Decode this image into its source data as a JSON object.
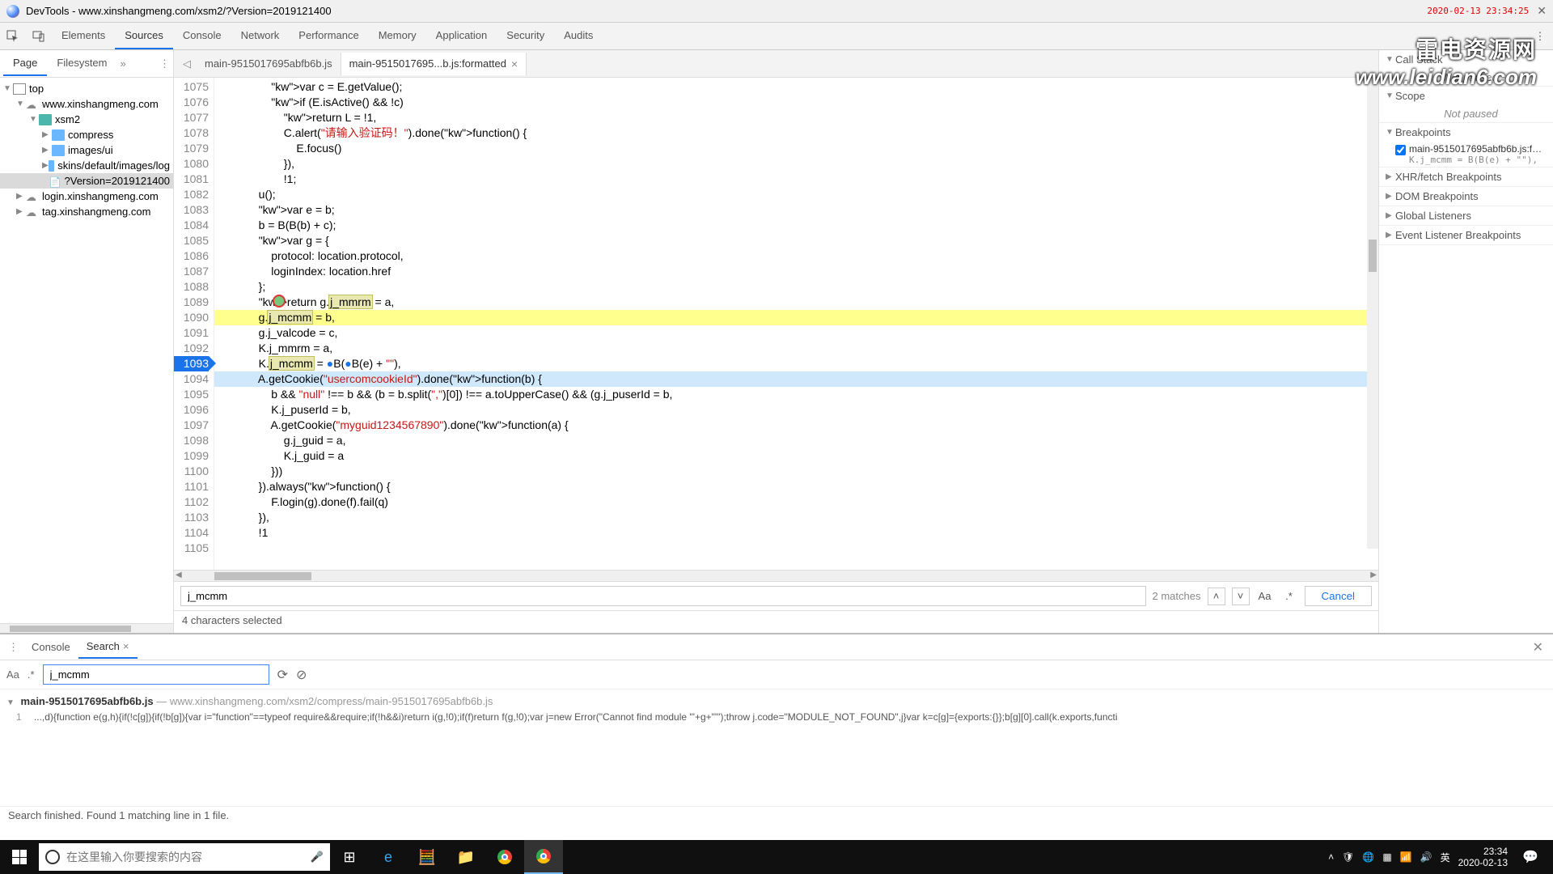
{
  "titlebar": {
    "title": "DevTools - www.xinshangmeng.com/xsm2/?Version=2019121400",
    "date_stamp": "2020-02-13 23:34:25"
  },
  "watermark": {
    "text": "雷电资源网",
    "url": "www.leidian6.com"
  },
  "devtools_tabs": [
    "Elements",
    "Sources",
    "Console",
    "Network",
    "Performance",
    "Memory",
    "Application",
    "Security",
    "Audits"
  ],
  "devtools_active": "Sources",
  "left": {
    "tabs": [
      "Page",
      "Filesystem"
    ],
    "active": "Page",
    "tree": [
      {
        "depth": 0,
        "arrow": "▼",
        "icon": "frame",
        "label": "top"
      },
      {
        "depth": 1,
        "arrow": "▼",
        "icon": "cloud",
        "label": "www.xinshangmeng.com"
      },
      {
        "depth": 2,
        "arrow": "▼",
        "icon": "folder-teal",
        "label": "xsm2"
      },
      {
        "depth": 3,
        "arrow": "▶",
        "icon": "folder-blue",
        "label": "compress"
      },
      {
        "depth": 3,
        "arrow": "▶",
        "icon": "folder-blue",
        "label": "images/ui"
      },
      {
        "depth": 3,
        "arrow": "▶",
        "icon": "folder-blue",
        "label": "skins/default/images/log"
      },
      {
        "depth": 3,
        "arrow": "",
        "icon": "file",
        "label": "?Version=2019121400",
        "selected": true
      },
      {
        "depth": 1,
        "arrow": "▶",
        "icon": "cloud",
        "label": "login.xinshangmeng.com"
      },
      {
        "depth": 1,
        "arrow": "▶",
        "icon": "cloud",
        "label": "tag.xinshangmeng.com"
      }
    ]
  },
  "editor": {
    "tabs": [
      {
        "label": "main-9515017695abfb6b.js",
        "active": false
      },
      {
        "label": "main-9515017695...b.js:formatted",
        "active": true
      }
    ],
    "first_line": 1075,
    "bp_line": 1093,
    "hl_line": 1090,
    "blue_line": 1094,
    "marker_line": 1089,
    "lines": [
      "                var c = E.getValue();",
      "                if (E.isActive() && !c)",
      "                    return L = !1,",
      "                    C.alert(\"请输入验证码！\").done(function() {",
      "                        E.focus()",
      "                    }),",
      "                    !1;",
      "            u();",
      "            var e = b;",
      "            b = B(B(b) + c);",
      "            var g = {",
      "                protocol: location.protocol,",
      "                loginIndex: location.href",
      "            };",
      "            return g.j_mmrm = a,",
      "            g.j_mcmm = b,",
      "            g.j_valcode = c,",
      "            K.j_mmrm = a,",
      "            K.j_mcmm = ●B(●B(e) + \"\"),",
      "            A.getCookie(\"usercomcookieId\").done(function(b) {",
      "                b && \"null\" !== b && (b = b.split(\",\")[0]) !== a.toUpperCase() && (g.j_puserId = b,",
      "                K.j_puserId = b,",
      "                A.getCookie(\"myguid1234567890\").done(function(a) {",
      "                    g.j_guid = a,",
      "                    K.j_guid = a",
      "                }))",
      "            }).always(function() {",
      "                F.login(g).done(f).fail(q)",
      "            }),",
      "            !1",
      ""
    ]
  },
  "find": {
    "value": "j_mcmm",
    "matches": "2 matches",
    "cancel": "Cancel"
  },
  "selection_status": "4 characters selected",
  "right": {
    "sections": [
      {
        "title": "Call Stack",
        "arrow": "▼",
        "body": "Not paused"
      },
      {
        "title": "Scope",
        "arrow": "▼",
        "body": "Not paused"
      },
      {
        "title": "Breakpoints",
        "arrow": "▼",
        "bp": {
          "file": "main-9515017695abfb6b.js:for...",
          "code": "K.j_mcmm = B(B(e) + \"\"),"
        }
      },
      {
        "title": "XHR/fetch Breakpoints",
        "arrow": "▶"
      },
      {
        "title": "DOM Breakpoints",
        "arrow": "▶"
      },
      {
        "title": "Global Listeners",
        "arrow": "▶"
      },
      {
        "title": "Event Listener Breakpoints",
        "arrow": "▶"
      }
    ]
  },
  "drawer": {
    "tabs": [
      {
        "label": "Console",
        "active": false
      },
      {
        "label": "Search",
        "active": true,
        "closable": true
      }
    ],
    "search_value": "j_mcmm",
    "result_file": "main-9515017695abfb6b.js",
    "result_path": " — www.xinshangmeng.com/xsm2/compress/main-9515017695abfb6b.js",
    "result_ln": "1",
    "result_text": "...,d){function e(g,h){if(!c[g]){if(!b[g]){var i=\"function\"==typeof require&&require;if(!h&&i)return i(g,!0);if(f)return f(g,!0);var j=new Error(\"Cannot find module '\"+g+\"'\");throw j.code=\"MODULE_NOT_FOUND\",j}var k=c[g]={exports:{}};b[g][0].call(k.exports,functi",
    "status": "Search finished. Found 1 matching line in 1 file."
  },
  "taskbar": {
    "search_placeholder": "在这里输入你要搜索的内容",
    "clock_time": "23:34",
    "clock_date": "2020-02-13",
    "ime": "英"
  }
}
